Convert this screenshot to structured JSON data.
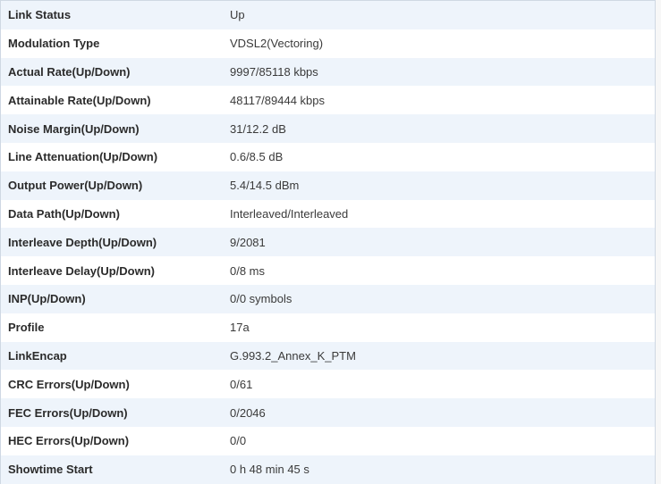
{
  "rows": [
    {
      "label": "Link Status",
      "value": "Up"
    },
    {
      "label": "Modulation Type",
      "value": "VDSL2(Vectoring)"
    },
    {
      "label": "Actual Rate(Up/Down)",
      "value": "9997/85118 kbps"
    },
    {
      "label": "Attainable Rate(Up/Down)",
      "value": "48117/89444 kbps"
    },
    {
      "label": "Noise Margin(Up/Down)",
      "value": "31/12.2 dB"
    },
    {
      "label": "Line Attenuation(Up/Down)",
      "value": "0.6/8.5 dB"
    },
    {
      "label": "Output Power(Up/Down)",
      "value": "5.4/14.5 dBm"
    },
    {
      "label": "Data Path(Up/Down)",
      "value": "Interleaved/Interleaved"
    },
    {
      "label": "Interleave Depth(Up/Down)",
      "value": "9/2081"
    },
    {
      "label": "Interleave Delay(Up/Down)",
      "value": "0/8 ms"
    },
    {
      "label": "INP(Up/Down)",
      "value": "0/0 symbols"
    },
    {
      "label": "Profile",
      "value": "17a"
    },
    {
      "label": "LinkEncap",
      "value": "G.993.2_Annex_K_PTM"
    },
    {
      "label": "CRC Errors(Up/Down)",
      "value": "0/61"
    },
    {
      "label": "FEC Errors(Up/Down)",
      "value": "0/2046"
    },
    {
      "label": "HEC Errors(Up/Down)",
      "value": "0/0"
    },
    {
      "label": "Showtime Start",
      "value": "0 h 48 min 45 s"
    }
  ]
}
